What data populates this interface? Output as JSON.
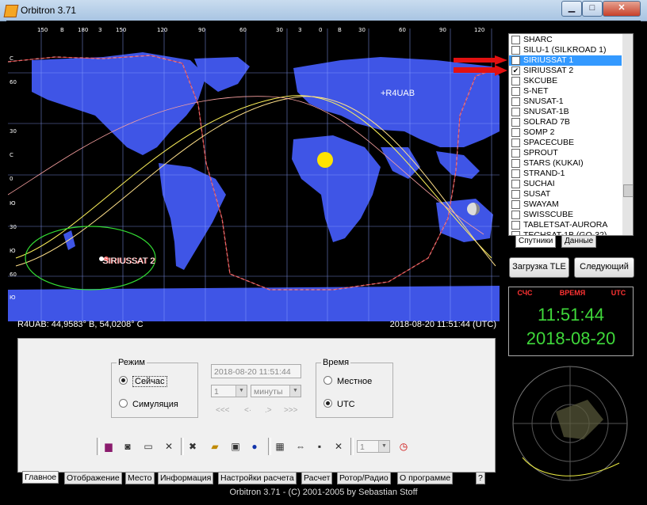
{
  "window": {
    "title": "Orbitron 3.71"
  },
  "map": {
    "header_labels": [
      "150",
      "В",
      "180",
      "З",
      "150",
      "120",
      "90",
      "60",
      "30",
      "З",
      "0",
      "В",
      "30",
      "60",
      "90",
      "120"
    ],
    "lat_labels": [
      "С",
      "60",
      "30",
      "С",
      "0",
      "Ю",
      "30",
      "Ю",
      "60",
      "Ю"
    ],
    "station_label": "+R4UAB",
    "sat_label": "SIRIUSSAT 2",
    "coord_text": "R4UAB: 44,9583° В, 54,0208° С",
    "time_text": "2018-08-20 11:51:44 (UTC)"
  },
  "satlist": {
    "items": [
      {
        "name": "SHARC",
        "checked": false,
        "selected": false
      },
      {
        "name": "SILU-1 (SILKROAD 1)",
        "checked": false,
        "selected": false
      },
      {
        "name": "SIRIUSSAT 1",
        "checked": true,
        "selected": true
      },
      {
        "name": "SIRIUSSAT 2",
        "checked": true,
        "selected": false
      },
      {
        "name": "SKCUBE",
        "checked": false,
        "selected": false
      },
      {
        "name": "S-NET",
        "checked": false,
        "selected": false
      },
      {
        "name": "SNUSAT-1",
        "checked": false,
        "selected": false
      },
      {
        "name": "SNUSAT-1B",
        "checked": false,
        "selected": false
      },
      {
        "name": "SOLRAD 7B",
        "checked": false,
        "selected": false
      },
      {
        "name": "SOMP 2",
        "checked": false,
        "selected": false
      },
      {
        "name": "SPACECUBE",
        "checked": false,
        "selected": false
      },
      {
        "name": "SPROUT",
        "checked": false,
        "selected": false
      },
      {
        "name": "STARS (KUKAI)",
        "checked": false,
        "selected": false
      },
      {
        "name": "STRAND-1",
        "checked": false,
        "selected": false
      },
      {
        "name": "SUCHAI",
        "checked": false,
        "selected": false
      },
      {
        "name": "SUSAT",
        "checked": false,
        "selected": false
      },
      {
        "name": "SWAYAM",
        "checked": false,
        "selected": false
      },
      {
        "name": "SWISSCUBE",
        "checked": false,
        "selected": false
      },
      {
        "name": "TABLETSAT-AURORA",
        "checked": false,
        "selected": false
      },
      {
        "name": "TECHSAT-1B (GO-32)",
        "checked": false,
        "selected": false
      }
    ],
    "tabs": [
      "Спутники",
      "Данные"
    ]
  },
  "buttons": {
    "load_tle": "Загрузка TLE",
    "next": "Следующий"
  },
  "clock": {
    "h1": "СЧС",
    "h2": "ВРЕМЯ",
    "h3": "UTC",
    "time": "11:51:44",
    "date": "2018-08-20"
  },
  "control": {
    "mode_title": "Режим",
    "mode_real": "Сейчас",
    "mode_sim": "Симуляция",
    "datetime": "2018-08-20 11:51:44",
    "step_value": "1",
    "step_unit": "минуты",
    "nav": [
      "<<<",
      "<·",
      ".>",
      ">>>"
    ],
    "time_title": "Время",
    "time_local": "Местное",
    "time_utc": "UTC",
    "speed_value": "1"
  },
  "toolbar_icons": [
    "book-icon",
    "camera-icon",
    "minimize-icon",
    "close-icon",
    "tools-icon",
    "folder-icon",
    "save-icon",
    "info-icon",
    "grid-icon",
    "resize-h-icon",
    "dots-icon",
    "expand-icon",
    "clock-icon"
  ],
  "tabs": [
    "Главное",
    "Отображение",
    "Место",
    "Информация",
    "Настройки расчета",
    "Расчет",
    "Ротор/Радио",
    "О программе",
    "?"
  ],
  "status": "Orbitron 3.71 - (C) 2001-2005 by Sebastian Stoff"
}
